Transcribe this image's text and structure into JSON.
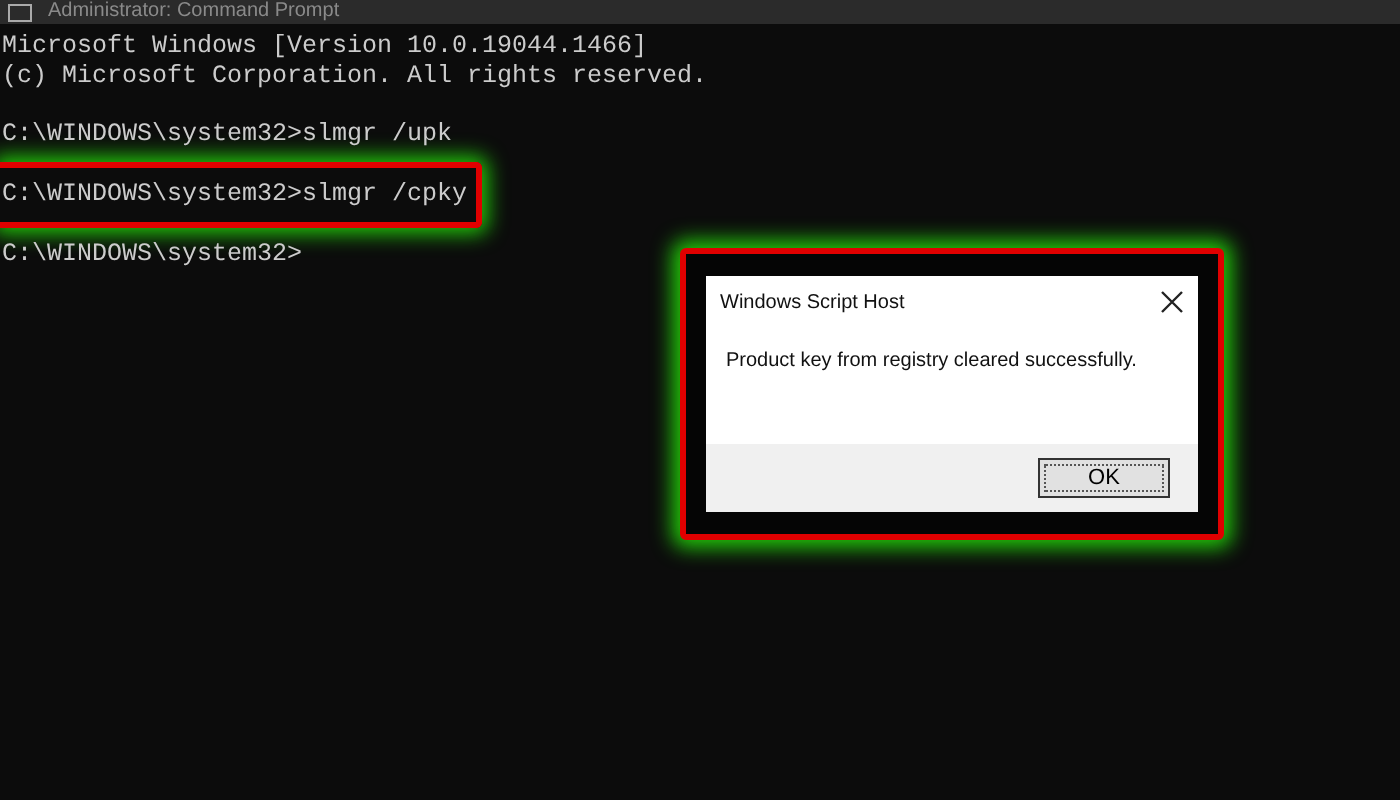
{
  "window": {
    "title": "Administrator: Command Prompt"
  },
  "console": {
    "lines": [
      {
        "text": "Microsoft Windows [Version 10.0.19044.1466]",
        "highlighted": false
      },
      {
        "text": "(c) Microsoft Corporation. All rights reserved.",
        "highlighted": false
      },
      {
        "kind": "blank"
      },
      {
        "text": "C:\\WINDOWS\\system32>slmgr /upk",
        "highlighted": false
      },
      {
        "text": "C:\\WINDOWS\\system32>slmgr /cpky",
        "highlighted": true
      },
      {
        "text": "C:\\WINDOWS\\system32>",
        "highlighted": false
      }
    ]
  },
  "dialog": {
    "title": "Windows Script Host",
    "message": "Product key from registry cleared successfully.",
    "button": "OK",
    "highlighted": true
  }
}
